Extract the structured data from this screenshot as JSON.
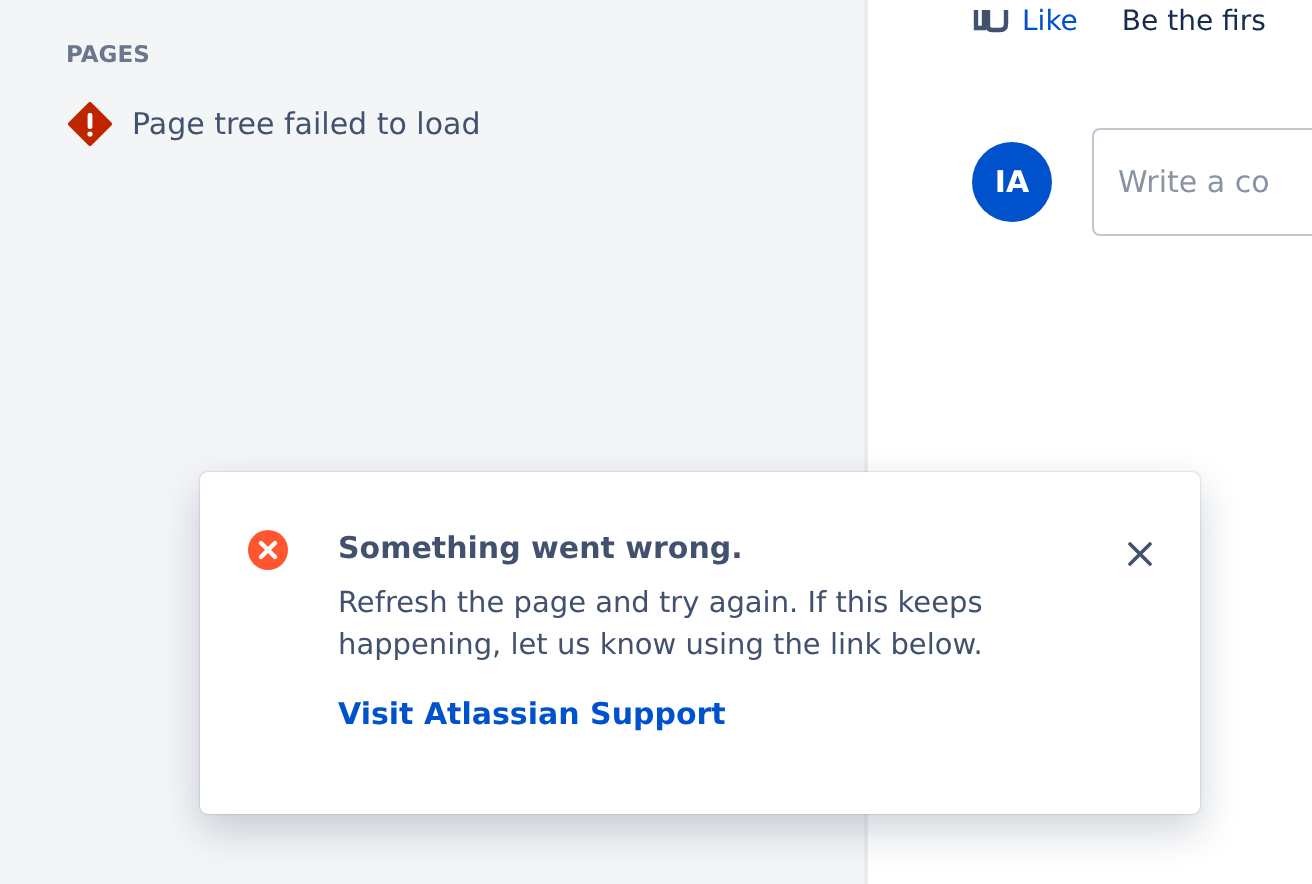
{
  "sidebar": {
    "heading": "PAGES",
    "error_text": "Page tree failed to load"
  },
  "reactions": {
    "like_label": "Like",
    "like_summary": "Be the firs"
  },
  "comment": {
    "avatar_initials": "IA",
    "placeholder": "Write a co"
  },
  "flag": {
    "title": "Something went wrong.",
    "message": "Refresh the page and try again. If this keeps happening, let us know using the link below.",
    "link": "Visit Atlassian Support"
  }
}
